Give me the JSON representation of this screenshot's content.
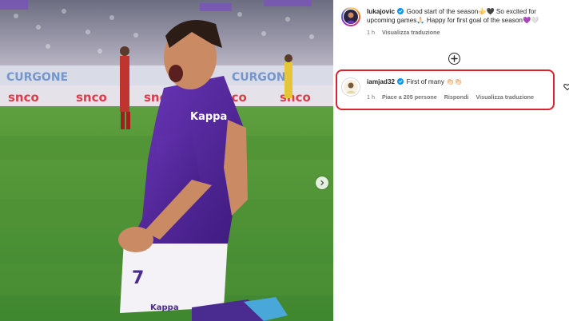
{
  "post": {
    "photo_alt": "Fiorentina player celebrating a goal",
    "next_icon": "chevron-right-icon"
  },
  "comments": [
    {
      "username": "lukajovic",
      "verified": true,
      "text": "Good start of the season⚜️🖤 So excited for upcoming games🙏🏻 Happy for first goal of the season💜🤍",
      "time": "1 h",
      "actions": [
        "Visualizza traduzione"
      ]
    },
    {
      "username": "iamjad32",
      "verified": true,
      "text": "First of many 👏🏻👏🏻",
      "time": "1 h",
      "actions": [
        "Piace a 205 persone",
        "Rispondi",
        "Visualizza traduzione"
      ]
    }
  ],
  "load_more_icon": "plus-circle-icon",
  "like_icon": "heart-icon",
  "colors": {
    "highlight": "#d9232f",
    "verified": "#0095f6",
    "meta": "#737373"
  }
}
